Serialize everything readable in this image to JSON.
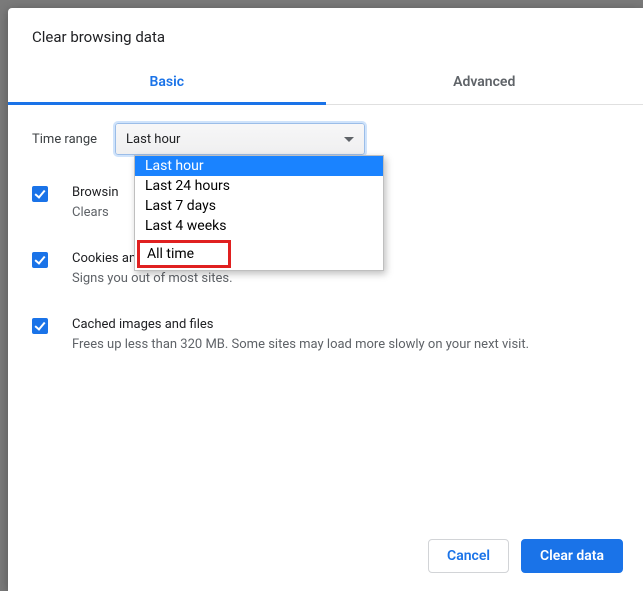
{
  "colors": {
    "accent": "#1a73e8",
    "highlight_box": "#e02020"
  },
  "dialog": {
    "title": "Clear browsing data",
    "tabs": {
      "basic": "Basic",
      "advanced": "Advanced"
    },
    "time_range_label": "Time range",
    "time_range_value": "Last hour",
    "time_range_options": [
      "Last hour",
      "Last 24 hours",
      "Last 7 days",
      "Last 4 weeks",
      "All time"
    ],
    "items": [
      {
        "title": "Browsing history",
        "title_visible": "Browsin",
        "subtitle": "Clears history from all signed-in devices.",
        "subtitle_visible": "Clears"
      },
      {
        "title": "Cookies and other site data",
        "subtitle": "Signs you out of most sites."
      },
      {
        "title": "Cached images and files",
        "subtitle": "Frees up less than 320 MB. Some sites may load more slowly on your next visit."
      }
    ],
    "buttons": {
      "cancel": "Cancel",
      "confirm": "Clear data"
    }
  }
}
